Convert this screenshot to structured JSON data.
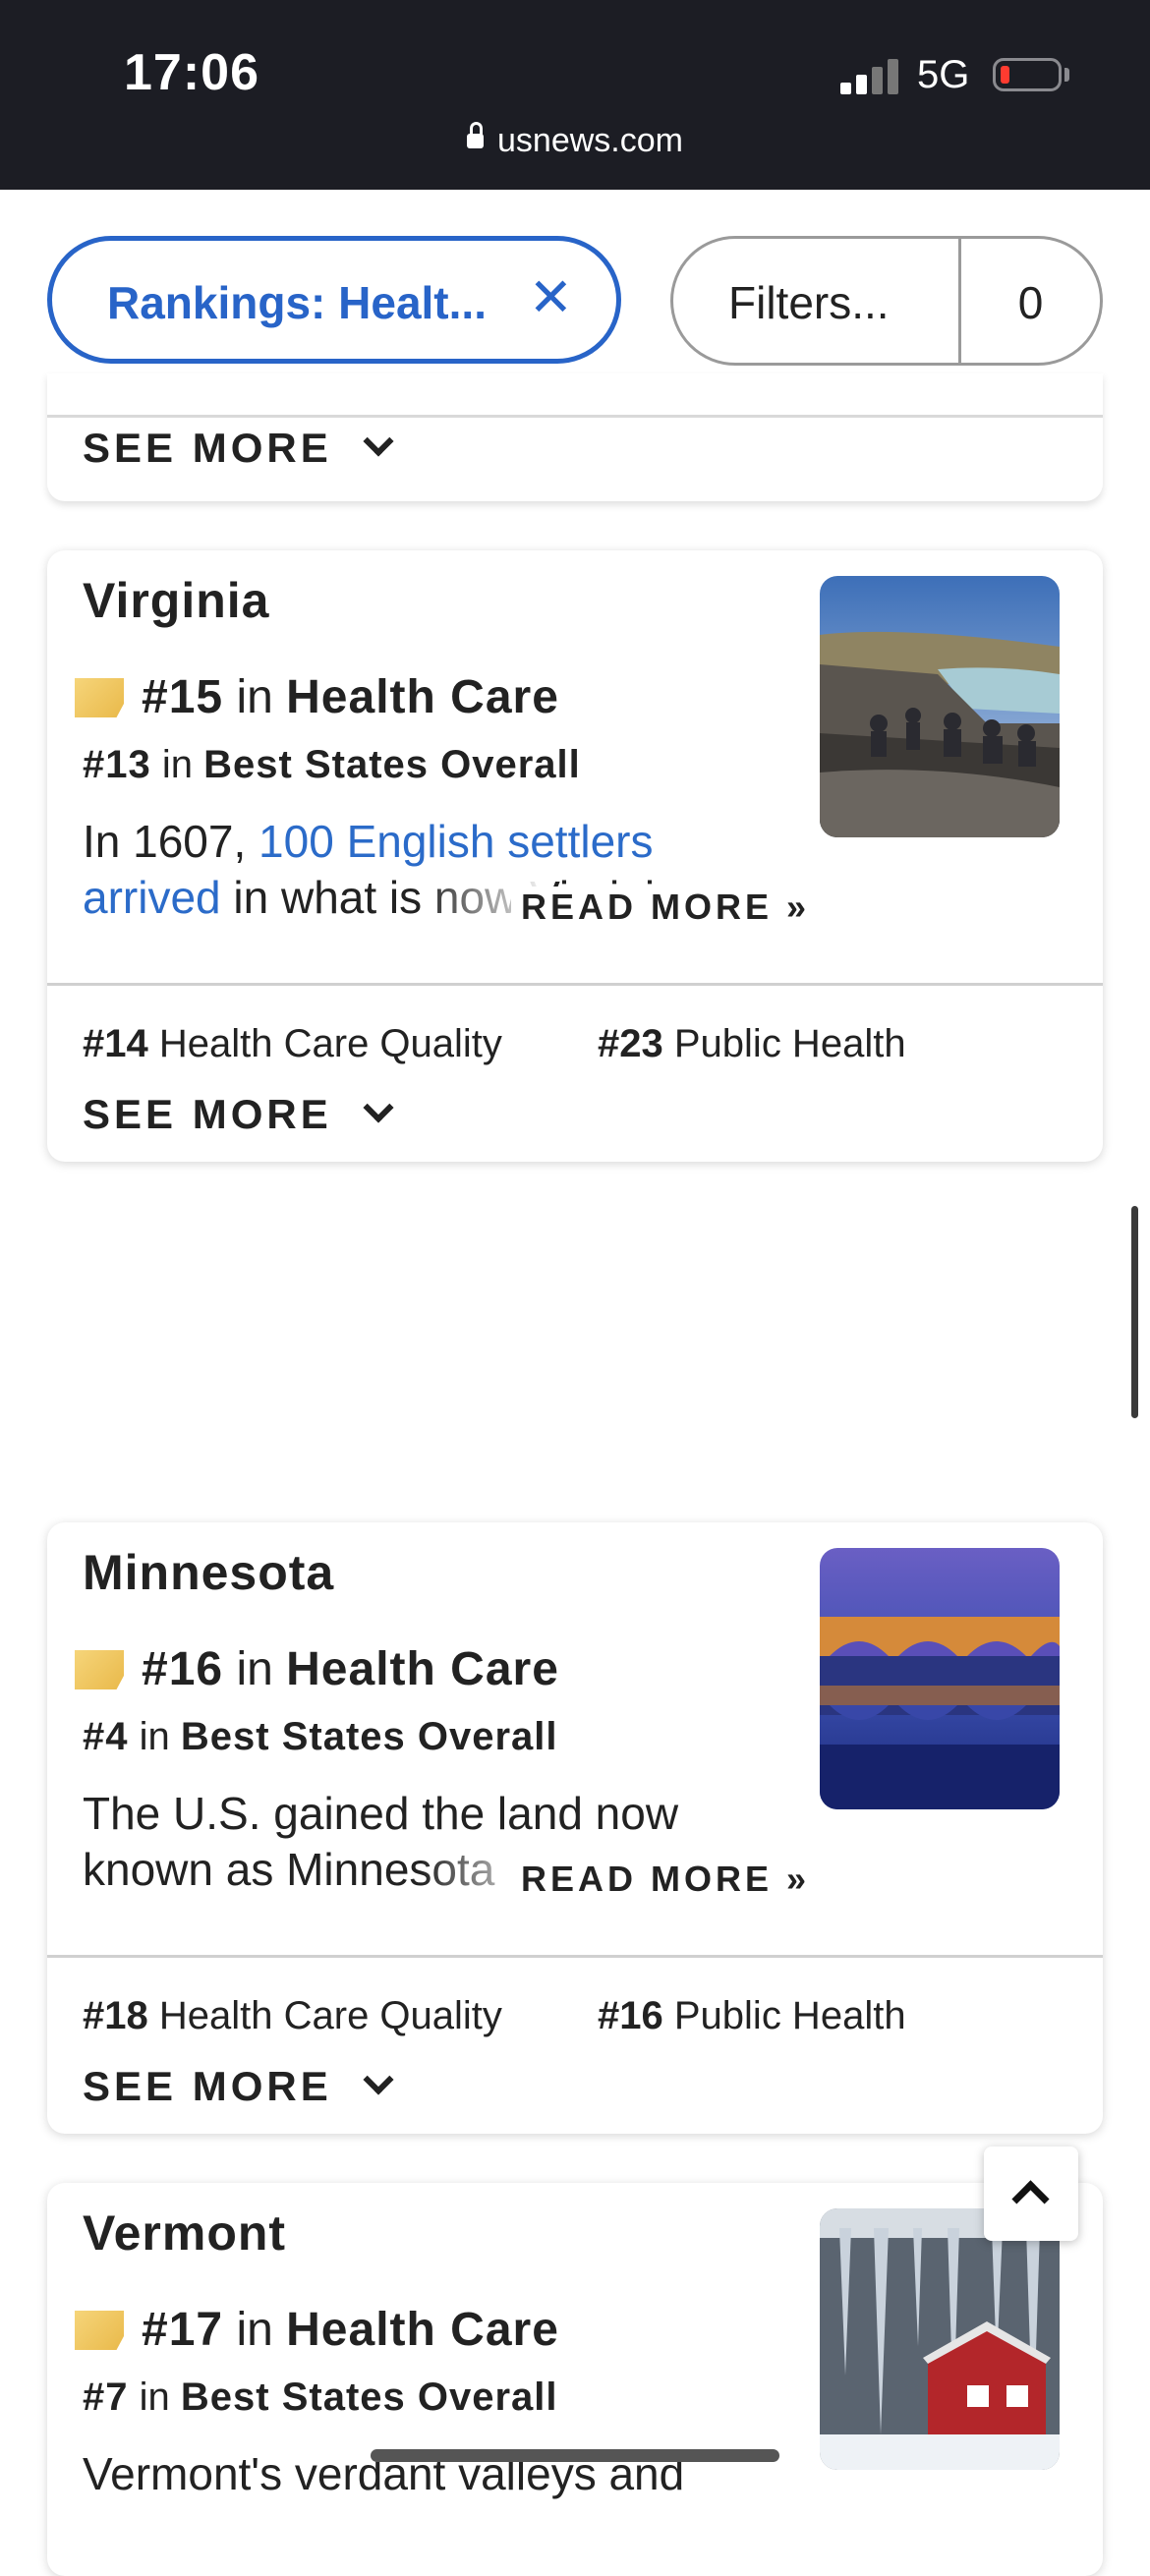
{
  "status_bar": {
    "time": "17:06",
    "network": "5G",
    "url": "usnews.com"
  },
  "filter_bar": {
    "chip_label": "Rankings: Healt...",
    "chip_clear": "✕",
    "filters_label": "Filters...",
    "filters_count": "0"
  },
  "prev_card": {
    "see_more": "SEE MORE"
  },
  "cards": [
    {
      "name": "Virginia",
      "rank": "#15",
      "rank_in": "in",
      "category": "Health Care",
      "overall_rank": "#13",
      "overall_in": "in",
      "overall_category": "Best States Overall",
      "desc_before": "In 1607, ",
      "desc_link": "100 English settlers arrived",
      "desc_after": " in what is now Virginia",
      "read_more": "READ MORE »",
      "sub1_rank": "#14",
      "sub1_label": "Health Care Quality",
      "sub2_rank": "#23",
      "sub2_label": "Public Health",
      "see_more": "SEE MORE",
      "photo_icon": "scenic-rocks-river-photo"
    },
    {
      "name": "Minnesota",
      "rank": "#16",
      "rank_in": "in",
      "category": "Health Care",
      "overall_rank": "#4",
      "overall_in": "in",
      "overall_category": "Best States Overall",
      "desc_before": "The U.S. gained the land now known as Minnesota",
      "read_more": "READ MORE »",
      "sub1_rank": "#18",
      "sub1_label": "Health Care Quality",
      "sub2_rank": "#16",
      "sub2_label": "Public Health",
      "see_more": "SEE MORE",
      "photo_icon": "stone-arch-bridge-photo"
    },
    {
      "name": "Vermont",
      "rank": "#17",
      "rank_in": "in",
      "category": "Health Care",
      "overall_rank": "#7",
      "overall_in": "in",
      "overall_category": "Best States Overall",
      "desc_before": "Vermont's verdant valleys and",
      "photo_icon": "icicles-red-barn-photo"
    }
  ]
}
